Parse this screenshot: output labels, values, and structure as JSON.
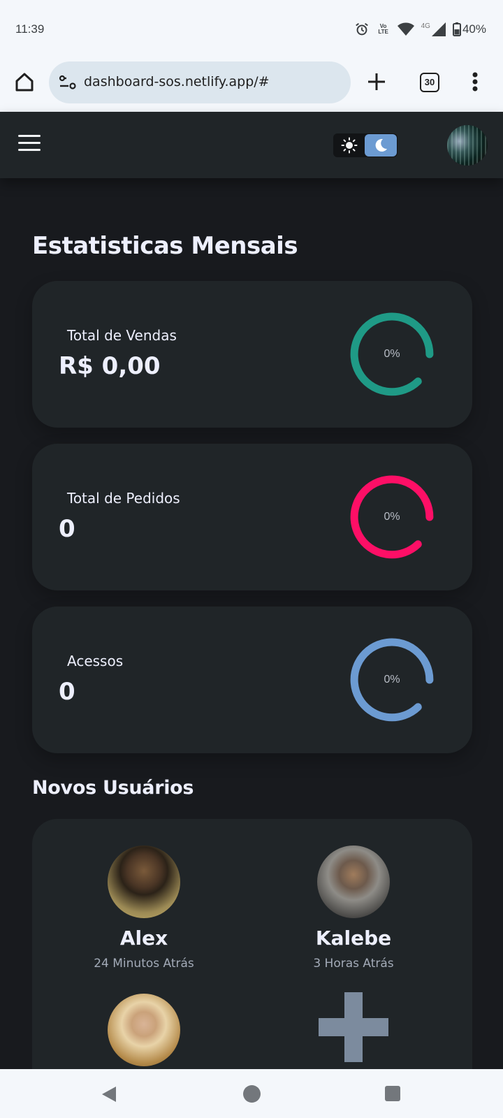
{
  "status_bar": {
    "time": "11:39",
    "network_label": "4G",
    "volte_label": "Vo LTE",
    "battery": "40%",
    "icons": [
      "alarm-icon",
      "volte-icon",
      "wifi-icon",
      "signal-icon",
      "battery-icon"
    ]
  },
  "browser": {
    "url": "dashboard-sos.netlify.app/#",
    "tab_count": "30",
    "icons": [
      "home-icon",
      "site-info-icon",
      "plus-icon",
      "tabs-icon",
      "more-vertical-icon"
    ]
  },
  "header": {
    "theme_mode": "dark",
    "accent_color": "#6c9bd2",
    "icons": [
      "hamburger-icon",
      "sun-icon",
      "moon-icon"
    ]
  },
  "stats": {
    "title": "Estatisticas Mensais",
    "cards": [
      {
        "label": "Total de Vendas",
        "value": "R$ 0,00",
        "percent_label": "0%",
        "percent": 0,
        "color": "#1f9a86"
      },
      {
        "label": "Total de Pedidos",
        "value": "0",
        "percent_label": "0%",
        "percent": 0,
        "color": "#fd0f66"
      },
      {
        "label": "Acessos",
        "value": "0",
        "percent_label": "0%",
        "percent": 0,
        "color": "#6c9bd2"
      }
    ]
  },
  "users": {
    "title": "Novos Usuários",
    "list": [
      {
        "name": "Alex",
        "time": "24 Minutos Atrás"
      },
      {
        "name": "Kalebe",
        "time": "3 Horas Atrás"
      }
    ]
  },
  "nav_bar": {
    "icons": [
      "back-icon",
      "home-circle-icon",
      "recents-icon"
    ]
  }
}
